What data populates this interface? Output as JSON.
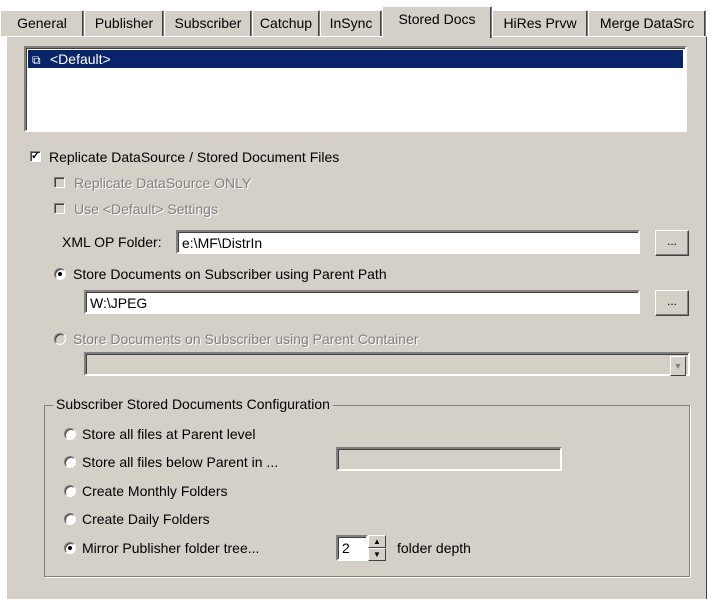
{
  "tabs": [
    {
      "label": "General",
      "active": false
    },
    {
      "label": "Publisher",
      "active": false
    },
    {
      "label": "Subscriber",
      "active": false
    },
    {
      "label": "Catchup",
      "active": false
    },
    {
      "label": "InSync",
      "active": false
    },
    {
      "label": "Stored Docs",
      "active": true
    },
    {
      "label": "HiRes Prvw",
      "active": false
    },
    {
      "label": "Merge DataSrc",
      "active": false
    }
  ],
  "datasource_list": {
    "items": [
      {
        "label": "<Default>",
        "selected": true,
        "icon": "copy-documents-icon"
      }
    ]
  },
  "options": {
    "replicate": {
      "label": "Replicate DataSource / Stored Document Files",
      "checked": true
    },
    "replicate_only": {
      "label": "Replicate DataSource ONLY",
      "checked": false,
      "enabled": false
    },
    "use_default": {
      "label": "Use <Default> Settings",
      "checked": false,
      "enabled": false
    }
  },
  "xml_op_folder": {
    "label": "XML OP Folder:",
    "value": "e:\\MF\\DistrIn",
    "browse_label": "..."
  },
  "store_parent_path": {
    "label": "Store Documents on Subscriber using Parent Path",
    "selected": true,
    "value": "W:\\JPEG",
    "browse_label": "..."
  },
  "store_parent_container": {
    "label": "Store Documents on Subscriber using Parent Container",
    "selected": false,
    "enabled": false,
    "value": ""
  },
  "config_group": {
    "title": "Subscriber Stored Documents Configuration",
    "options": [
      {
        "label": "Store all files at Parent level",
        "selected": false
      },
      {
        "label": "Store all files below Parent in ...",
        "selected": false
      },
      {
        "label": "Create Monthly Folders",
        "selected": false
      },
      {
        "label": "Create Daily Folders",
        "selected": false
      },
      {
        "label": "Mirror Publisher folder tree...",
        "selected": true
      }
    ],
    "below_parent_value": "",
    "folder_depth": {
      "value": "2",
      "label": "folder depth"
    }
  }
}
